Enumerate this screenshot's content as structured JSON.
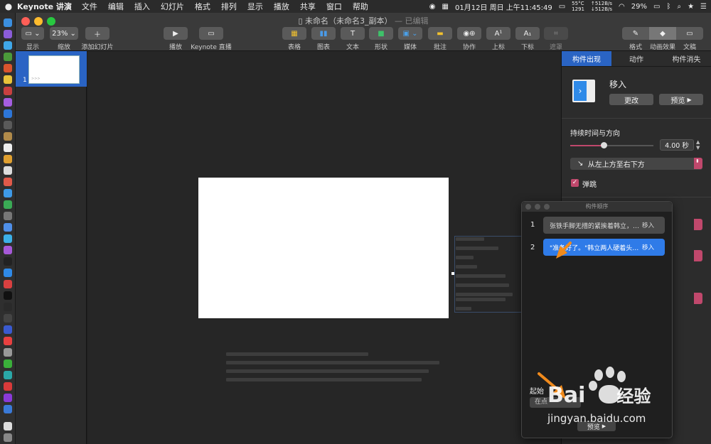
{
  "menubar": {
    "app_name": "Keynote 讲演",
    "items": [
      "文件",
      "编辑",
      "插入",
      "幻灯片",
      "格式",
      "排列",
      "显示",
      "播放",
      "共享",
      "窗口",
      "帮助"
    ],
    "datetime": "01月12日 周日 上午11:45:49",
    "temp": "55°C",
    "rpm": "1291",
    "net_up": "↑512B/s",
    "net_down": "↓512B/s",
    "battery": "29%"
  },
  "window": {
    "title": "未命名（未命名3_副本）",
    "edited": "— 已编辑"
  },
  "toolbar": {
    "zoom": "23%",
    "labels": {
      "view": "显示",
      "zoom": "缩放",
      "add_slide": "添加幻灯片",
      "play": "播放",
      "keynote_live": "Keynote 直播",
      "table": "表格",
      "chart": "图表",
      "text": "文本",
      "shape": "形状",
      "media": "媒体",
      "comment": "批注",
      "collaborate": "协作",
      "superscript": "上标",
      "subscript": "下标",
      "mask": "遮罩",
      "format": "格式",
      "animate": "动画效果",
      "document": "文稿"
    }
  },
  "navigator": {
    "slide_number": "1",
    "thumb_text": ">>>"
  },
  "inspector": {
    "tabs": [
      "构件出现",
      "动作",
      "构件消失"
    ],
    "effect_name": "移入",
    "change_label": "更改",
    "preview_label": "预览",
    "duration_section": "持续时间与方向",
    "duration_value": "4.00 秒",
    "duration_fraction": 0.4,
    "direction": "从左上方至右下方",
    "bounce_label": "弹跳",
    "bounce_checked": true
  },
  "build_order": {
    "title": "构件顺序",
    "items": [
      {
        "num": "1",
        "text": "张铁手脚无措的紧挨着韩立，…",
        "action": "移入"
      },
      {
        "num": "2",
        "text": "\"准备好了。\"韩立两人硬着头…",
        "action": "移入"
      }
    ],
    "start_label": "起始",
    "start_value": "在点",
    "preview_label": "预览"
  },
  "watermark": {
    "brand_a": "Bai",
    "brand_b": "经验",
    "url": "jingyan.baidu.com"
  },
  "colors": {
    "accent": "#2a64c4",
    "item_inactive": "#4a4a4a",
    "item_active": "#2f7be8",
    "pink": "#c0486c",
    "arrow": "#f08a1c"
  }
}
